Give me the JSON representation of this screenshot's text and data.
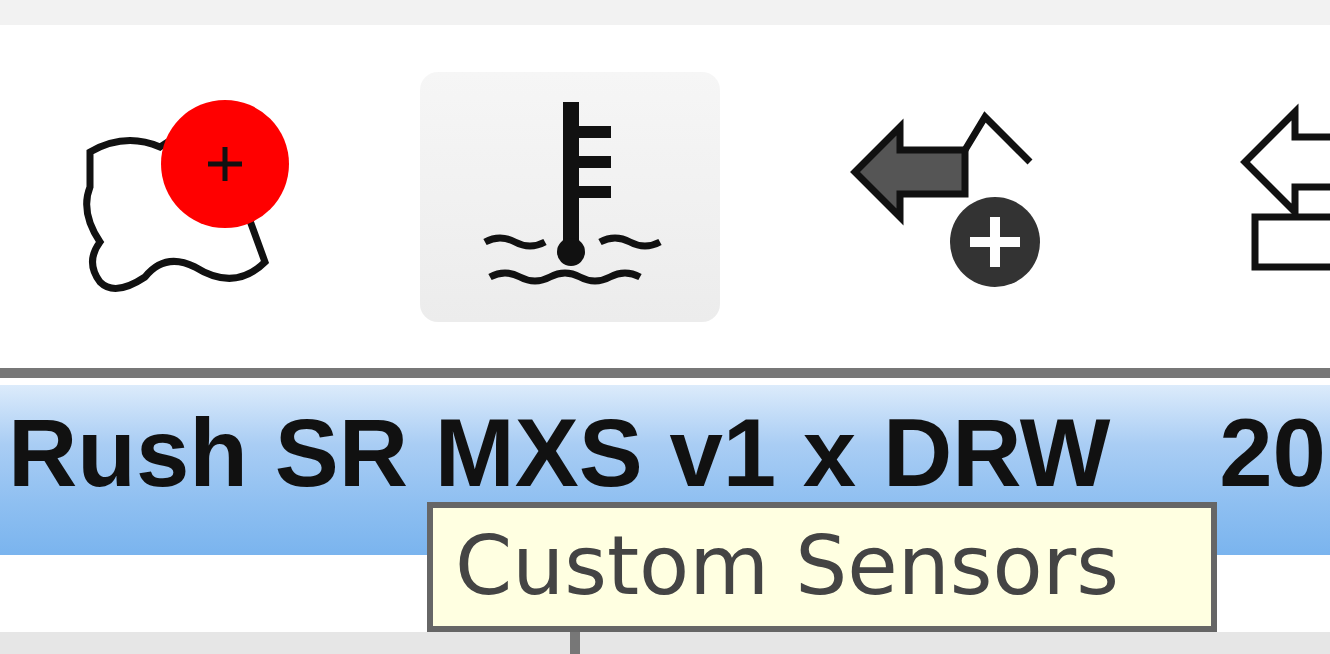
{
  "toolbar": {
    "buttons": [
      {
        "kind": "map-add",
        "hovered": false
      },
      {
        "kind": "sensor",
        "hovered": true
      },
      {
        "kind": "arrow-add",
        "hovered": false
      },
      {
        "kind": "swap",
        "hovered": false
      }
    ]
  },
  "title_bar": {
    "title": "Rush SR MXS v1 x DRW",
    "suffix": "20"
  },
  "tooltip": {
    "text": "Custom Sensors"
  }
}
